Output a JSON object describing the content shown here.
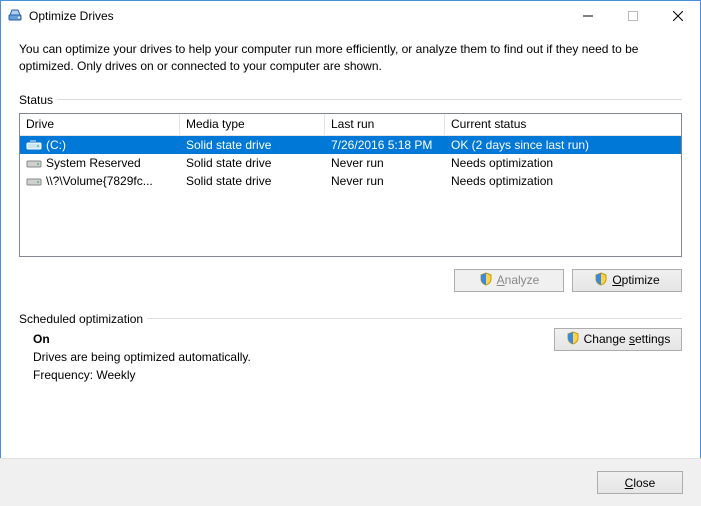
{
  "window": {
    "title": "Optimize Drives"
  },
  "intro": "You can optimize your drives to help your computer run more efficiently, or analyze them to find out if they need to be optimized. Only drives on or connected to your computer are shown.",
  "status_label": "Status",
  "columns": {
    "drive": "Drive",
    "media": "Media type",
    "lastrun": "Last run",
    "status": "Current status"
  },
  "drives": [
    {
      "name": "(C:)",
      "media": "Solid state drive",
      "lastrun": "7/26/2016 5:18 PM",
      "status": "OK (2 days since last run)",
      "selected": true,
      "icon": "os-drive"
    },
    {
      "name": "System Reserved",
      "media": "Solid state drive",
      "lastrun": "Never run",
      "status": "Needs optimization",
      "selected": false,
      "icon": "hdd"
    },
    {
      "name": "\\\\?\\Volume{7829fc...",
      "media": "Solid state drive",
      "lastrun": "Never run",
      "status": "Needs optimization",
      "selected": false,
      "icon": "hdd"
    }
  ],
  "buttons": {
    "analyze_prefix": "",
    "analyze_hot": "A",
    "analyze_suffix": "nalyze",
    "optimize_prefix": "",
    "optimize_hot": "O",
    "optimize_suffix": "ptimize",
    "change_prefix": "Change ",
    "change_hot": "s",
    "change_suffix": "ettings",
    "close_prefix": "",
    "close_hot": "C",
    "close_suffix": "lose"
  },
  "sched": {
    "label": "Scheduled optimization",
    "on": "On",
    "desc": "Drives are being optimized automatically.",
    "freq": "Frequency: Weekly"
  }
}
